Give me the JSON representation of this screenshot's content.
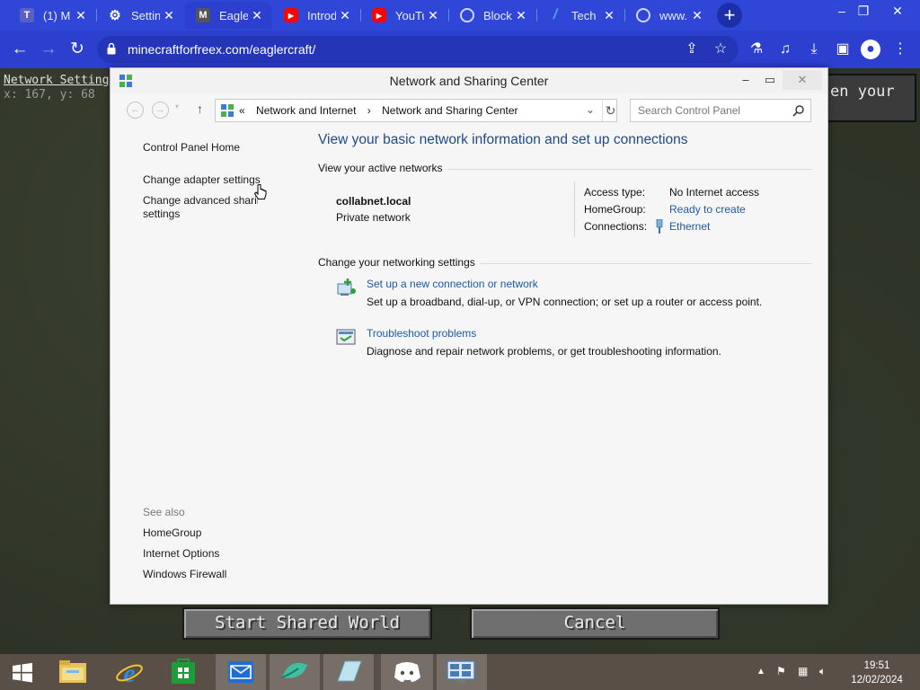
{
  "browser": {
    "tabs": [
      {
        "title": "(1) M",
        "icon": "teams-icon",
        "color": "#5b5fc7"
      },
      {
        "title": "Settin",
        "icon": "gear-icon",
        "color": "#ffffff"
      },
      {
        "title": "Eagle",
        "icon": "m-icon",
        "color": "#4a4a4a"
      },
      {
        "title": "Introd",
        "icon": "youtube-icon",
        "color": "#ff0000"
      },
      {
        "title": "YouTu",
        "icon": "youtube-icon",
        "color": "#ff0000"
      },
      {
        "title": "Block",
        "icon": "globe-icon",
        "color": "#cfd6ff"
      },
      {
        "title": "Tech",
        "icon": "t-icon",
        "color": "#4fa3ff"
      },
      {
        "title": "www.",
        "icon": "globe-icon",
        "color": "#cfd6ff"
      }
    ],
    "url": "minecraftforfreex.com/eaglercraft/"
  },
  "game": {
    "topleft_text": "Network Setting",
    "coords_text": "x: 167, y: 68",
    "hint_text": "en your",
    "start_button": "Start Shared World",
    "cancel_button": "Cancel"
  },
  "dialog": {
    "title": "Network and Sharing Center",
    "breadcrumb": {
      "chevron": "«",
      "part1": "Network and Internet",
      "sep": "›",
      "part2": "Network and Sharing Center"
    },
    "search_placeholder": "Search Control Panel",
    "left_nav": {
      "home": "Control Panel Home",
      "adapter": "Change adapter settings",
      "advanced1": "Change advanced sharing",
      "advanced2": "settings"
    },
    "see_also": {
      "label": "See also",
      "links": [
        "HomeGroup",
        "Internet Options",
        "Windows Firewall"
      ]
    },
    "main_title": "View your basic network information and set up connections",
    "active_networks_label": "View your active networks",
    "network": {
      "name": "collabnet.local",
      "type": "Private network"
    },
    "details": {
      "access_type_label": "Access type:",
      "access_type_value": "No Internet access",
      "homegroup_label": "HomeGroup:",
      "homegroup_value": "Ready to create",
      "connections_label": "Connections:",
      "connections_value": "Ethernet"
    },
    "change_settings_label": "Change your networking settings",
    "tasks": [
      {
        "title": "Set up a new connection or network",
        "desc": "Set up a broadband, dial-up, or VPN connection; or set up a router or access point."
      },
      {
        "title": "Troubleshoot problems",
        "desc": "Diagnose and repair network problems, or get troubleshooting information."
      }
    ]
  },
  "taskbar": {
    "apps": [
      "start-icon",
      "file-explorer-icon",
      "internet-explorer-icon",
      "store-icon",
      "mail-icon",
      "app-icon",
      "notes-icon",
      "discord-icon",
      "remote-desktop-icon"
    ],
    "time": "19:51",
    "date": "12/02/2024"
  },
  "colors": {
    "browser_blue": "#3046d6",
    "link_blue": "#1d5aa8",
    "title_blue": "#1e4a8c"
  }
}
